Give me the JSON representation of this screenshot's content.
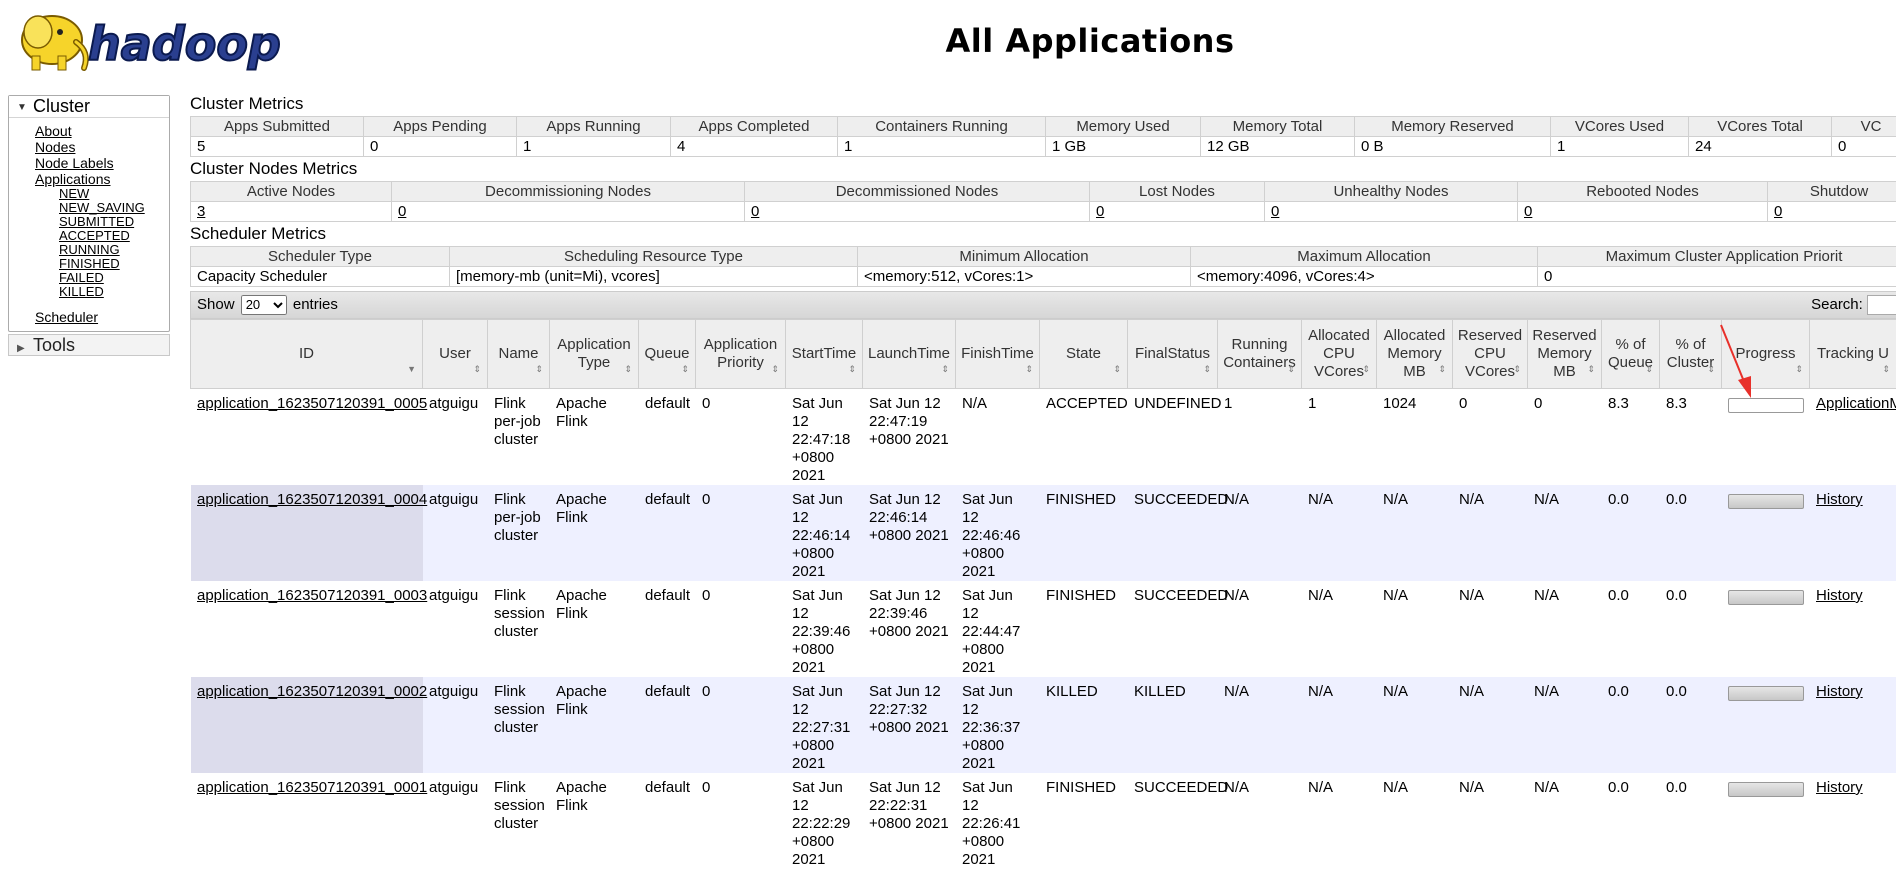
{
  "page_title": "All Applications",
  "logo": {
    "text": "hadoop"
  },
  "sidebar": {
    "cluster_label": "Cluster",
    "items": [
      "About",
      "Nodes",
      "Node Labels",
      "Applications"
    ],
    "app_states": [
      "NEW",
      "NEW_SAVING",
      "SUBMITTED",
      "ACCEPTED",
      "RUNNING",
      "FINISHED",
      "FAILED",
      "KILLED"
    ],
    "scheduler": "Scheduler",
    "tools_label": "Tools"
  },
  "cluster_metrics": {
    "title": "Cluster Metrics",
    "headers": [
      "Apps Submitted",
      "Apps Pending",
      "Apps Running",
      "Apps Completed",
      "Containers Running",
      "Memory Used",
      "Memory Total",
      "Memory Reserved",
      "VCores Used",
      "VCores Total",
      "VC"
    ],
    "values": [
      "5",
      "0",
      "1",
      "4",
      "1",
      "1 GB",
      "12 GB",
      "0 B",
      "1",
      "24",
      "0"
    ]
  },
  "nodes_metrics": {
    "title": "Cluster Nodes Metrics",
    "headers": [
      "Active Nodes",
      "Decommissioning Nodes",
      "Decommissioned Nodes",
      "Lost Nodes",
      "Unhealthy Nodes",
      "Rebooted Nodes",
      "Shutdow"
    ],
    "values": [
      "3",
      "0",
      "0",
      "0",
      "0",
      "0",
      "0"
    ]
  },
  "scheduler_metrics": {
    "title": "Scheduler Metrics",
    "headers": [
      "Scheduler Type",
      "Scheduling Resource Type",
      "Minimum Allocation",
      "Maximum Allocation",
      "Maximum Cluster Application Priorit"
    ],
    "values": [
      "Capacity Scheduler",
      "[memory-mb (unit=Mi), vcores]",
      "<memory:512, vCores:1>",
      "<memory:4096, vCores:4>",
      "0"
    ]
  },
  "datatable": {
    "show_label": "Show",
    "entries_value": "20",
    "entries_label": "entries",
    "search_label": "Search:"
  },
  "apps_table": {
    "headers": [
      "ID",
      "User",
      "Name",
      "Application Type",
      "Queue",
      "Application Priority",
      "StartTime",
      "LaunchTime",
      "FinishTime",
      "State",
      "FinalStatus",
      "Running Containers",
      "Allocated CPU VCores",
      "Allocated Memory MB",
      "Reserved CPU VCores",
      "Reserved Memory MB",
      "% of Queue",
      "% of Cluster",
      "Progress",
      "Tracking U"
    ],
    "rows": [
      {
        "id": "application_1623507120391_0005",
        "user": "atguigu",
        "name": "Flink per-job cluster",
        "type": "Apache Flink",
        "queue": "default",
        "priority": "0",
        "start": "Sat Jun 12 22:47:18 +0800 2021",
        "launch": "Sat Jun 12 22:47:19 +0800 2021",
        "finish": "N/A",
        "state": "ACCEPTED",
        "final": "UNDEFINED",
        "running": "1",
        "cpu": "1",
        "mem": "1024",
        "rcpu": "0",
        "rmem": "0",
        "pq": "8.3",
        "pc": "8.3",
        "progress": 0,
        "tracking": "ApplicationM"
      },
      {
        "id": "application_1623507120391_0004",
        "user": "atguigu",
        "name": "Flink per-job cluster",
        "type": "Apache Flink",
        "queue": "default",
        "priority": "0",
        "start": "Sat Jun 12 22:46:14 +0800 2021",
        "launch": "Sat Jun 12 22:46:14 +0800 2021",
        "finish": "Sat Jun 12 22:46:46 +0800 2021",
        "state": "FINISHED",
        "final": "SUCCEEDED",
        "running": "N/A",
        "cpu": "N/A",
        "mem": "N/A",
        "rcpu": "N/A",
        "rmem": "N/A",
        "pq": "0.0",
        "pc": "0.0",
        "progress": 100,
        "tracking": "History"
      },
      {
        "id": "application_1623507120391_0003",
        "user": "atguigu",
        "name": "Flink session cluster",
        "type": "Apache Flink",
        "queue": "default",
        "priority": "0",
        "start": "Sat Jun 12 22:39:46 +0800 2021",
        "launch": "Sat Jun 12 22:39:46 +0800 2021",
        "finish": "Sat Jun 12 22:44:47 +0800 2021",
        "state": "FINISHED",
        "final": "SUCCEEDED",
        "running": "N/A",
        "cpu": "N/A",
        "mem": "N/A",
        "rcpu": "N/A",
        "rmem": "N/A",
        "pq": "0.0",
        "pc": "0.0",
        "progress": 100,
        "tracking": "History"
      },
      {
        "id": "application_1623507120391_0002",
        "user": "atguigu",
        "name": "Flink session cluster",
        "type": "Apache Flink",
        "queue": "default",
        "priority": "0",
        "start": "Sat Jun 12 22:27:31 +0800 2021",
        "launch": "Sat Jun 12 22:27:32 +0800 2021",
        "finish": "Sat Jun 12 22:36:37 +0800 2021",
        "state": "KILLED",
        "final": "KILLED",
        "running": "N/A",
        "cpu": "N/A",
        "mem": "N/A",
        "rcpu": "N/A",
        "rmem": "N/A",
        "pq": "0.0",
        "pc": "0.0",
        "progress": 100,
        "tracking": "History"
      },
      {
        "id": "application_1623507120391_0001",
        "user": "atguigu",
        "name": "Flink session cluster",
        "type": "Apache Flink",
        "queue": "default",
        "priority": "0",
        "start": "Sat Jun 12 22:22:29 +0800 2021",
        "launch": "Sat Jun 12 22:22:31 +0800 2021",
        "finish": "Sat Jun 12 22:26:41 +0800 2021",
        "state": "FINISHED",
        "final": "SUCCEEDED",
        "running": "N/A",
        "cpu": "N/A",
        "mem": "N/A",
        "rcpu": "N/A",
        "rmem": "N/A",
        "pq": "0.0",
        "pc": "0.0",
        "progress": 100,
        "tracking": "History"
      }
    ]
  },
  "colors": {
    "annotation_arrow": "#e8302a",
    "even_row": "#eef0ff",
    "header_bg": "#eeeeee"
  }
}
